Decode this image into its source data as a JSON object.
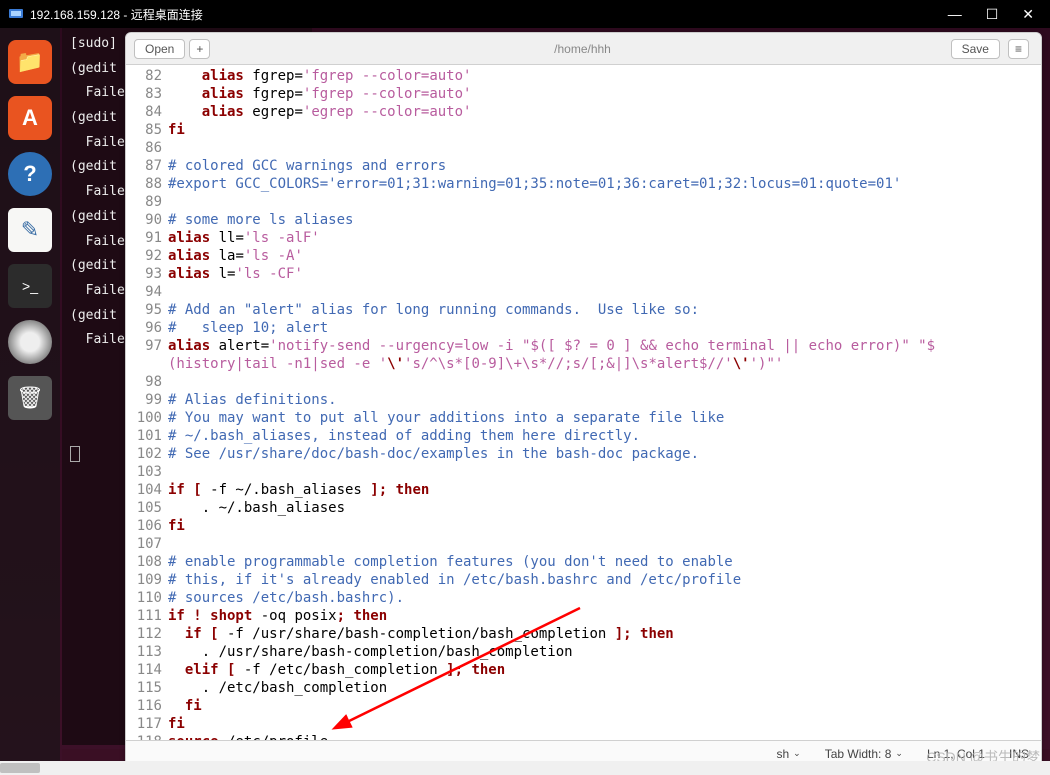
{
  "titlebar": {
    "title": "192.168.159.128 - 远程桌面连接"
  },
  "window_controls": {
    "min": "—",
    "max": "☐",
    "close": "✕"
  },
  "dock": {
    "files": "📁",
    "software": "A",
    "help": "?",
    "gedit": "✎",
    "terminal": ">_",
    "disc": "⦿",
    "trash": "🗑"
  },
  "terminal_lines": [
    "[sudo]",
    "",
    "(gedit",
    "  Faile",
    "",
    "(gedit",
    "  Faile",
    "",
    "(gedit",
    "  Faile",
    "",
    "(gedit",
    "  Faile",
    "",
    "(gedit",
    "  Faile",
    "",
    "(gedit",
    "  Faile"
  ],
  "editor": {
    "open_btn": "Open",
    "plus_btn": "+",
    "path": "/home/hhh",
    "save_btn": "Save",
    "menu_btn": "≡",
    "statusbar": {
      "lang": "sh",
      "tabwidth": "Tab Width: 8",
      "cursor": "Ln 1, Col 1",
      "ins": "INS"
    }
  },
  "code": [
    {
      "n": "82",
      "t": [
        [
          "    ",
          ""
        ],
        [
          "alias",
          "kw"
        ],
        [
          " fgrep=",
          ""
        ],
        [
          "'fgrep --color=auto'",
          "str"
        ]
      ],
      "partial_top": true
    },
    {
      "n": "83",
      "t": [
        [
          "    ",
          ""
        ],
        [
          "alias",
          "kw"
        ],
        [
          " fgrep=",
          ""
        ],
        [
          "'fgrep --color=auto'",
          "str"
        ]
      ]
    },
    {
      "n": "84",
      "t": [
        [
          "    ",
          ""
        ],
        [
          "alias",
          "kw"
        ],
        [
          " egrep=",
          ""
        ],
        [
          "'egrep --color=auto'",
          "str"
        ]
      ]
    },
    {
      "n": "85",
      "t": [
        [
          "fi",
          "kw"
        ]
      ]
    },
    {
      "n": "86",
      "t": []
    },
    {
      "n": "87",
      "t": [
        [
          "# colored GCC warnings and errors",
          "cmt"
        ]
      ]
    },
    {
      "n": "88",
      "t": [
        [
          "#export GCC_COLORS='error=01;31:warning=01;35:note=01;36:caret=01;32:locus=01:quote=01'",
          "cmt"
        ]
      ]
    },
    {
      "n": "89",
      "t": []
    },
    {
      "n": "90",
      "t": [
        [
          "# some more ls aliases",
          "cmt"
        ]
      ]
    },
    {
      "n": "91",
      "t": [
        [
          "alias",
          "kw"
        ],
        [
          " ll=",
          ""
        ],
        [
          "'ls -alF'",
          "str"
        ]
      ]
    },
    {
      "n": "92",
      "t": [
        [
          "alias",
          "kw"
        ],
        [
          " la=",
          ""
        ],
        [
          "'ls -A'",
          "str"
        ]
      ]
    },
    {
      "n": "93",
      "t": [
        [
          "alias",
          "kw"
        ],
        [
          " l=",
          ""
        ],
        [
          "'ls -CF'",
          "str"
        ]
      ]
    },
    {
      "n": "94",
      "t": []
    },
    {
      "n": "95",
      "t": [
        [
          "# Add an \"alert\" alias for long running commands.  Use like so:",
          "cmt"
        ]
      ]
    },
    {
      "n": "96",
      "t": [
        [
          "#   sleep 10; alert",
          "cmt"
        ]
      ]
    },
    {
      "n": "97",
      "t": [
        [
          "alias",
          "kw"
        ],
        [
          " alert=",
          ""
        ],
        [
          "'notify-send --urgency=low -i \"$([ $? = 0 ] && echo terminal || echo error)\" \"$",
          "str"
        ]
      ]
    },
    {
      "n": "",
      "t": [
        [
          "(history|tail -n1|sed -e '",
          "str"
        ],
        [
          "\\'",
          "kw"
        ],
        [
          "'s/^\\s*[0-9]\\+\\s*//;s/[;&|]\\s*alert$//'",
          "str"
        ],
        [
          "\\'",
          "kw"
        ],
        [
          "')\"'",
          "str"
        ]
      ]
    },
    {
      "n": "98",
      "t": []
    },
    {
      "n": "99",
      "t": [
        [
          "# Alias definitions.",
          "cmt"
        ]
      ]
    },
    {
      "n": "100",
      "t": [
        [
          "# You may want to put all your additions into a separate file like",
          "cmt"
        ]
      ]
    },
    {
      "n": "101",
      "t": [
        [
          "# ~/.bash_aliases, instead of adding them here directly.",
          "cmt"
        ]
      ]
    },
    {
      "n": "102",
      "t": [
        [
          "# See /usr/share/doc/bash-doc/examples in the bash-doc package.",
          "cmt"
        ]
      ]
    },
    {
      "n": "103",
      "t": []
    },
    {
      "n": "104",
      "t": [
        [
          "if [",
          "kw"
        ],
        [
          " -f ~/.bash_aliases ",
          ""
        ],
        [
          "]; then",
          "kw"
        ]
      ]
    },
    {
      "n": "105",
      "t": [
        [
          "    . ~/.bash_aliases",
          ""
        ]
      ]
    },
    {
      "n": "106",
      "t": [
        [
          "fi",
          "kw"
        ]
      ]
    },
    {
      "n": "107",
      "t": []
    },
    {
      "n": "108",
      "t": [
        [
          "# enable programmable completion features (you don't need to enable",
          "cmt"
        ]
      ]
    },
    {
      "n": "109",
      "t": [
        [
          "# this, if it's already enabled in /etc/bash.bashrc and /etc/profile",
          "cmt"
        ]
      ]
    },
    {
      "n": "110",
      "t": [
        [
          "# sources /etc/bash.bashrc).",
          "cmt"
        ]
      ]
    },
    {
      "n": "111",
      "t": [
        [
          "if ! shopt",
          "kw"
        ],
        [
          " -oq posix",
          ""
        ],
        [
          "; then",
          "kw"
        ]
      ]
    },
    {
      "n": "112",
      "t": [
        [
          "  ",
          ""
        ],
        [
          "if [",
          "kw"
        ],
        [
          " -f /usr/share/bash-completion/bash_completion ",
          ""
        ],
        [
          "]; then",
          "kw"
        ]
      ]
    },
    {
      "n": "113",
      "t": [
        [
          "    . /usr/share/bash-completion/bash_completion",
          ""
        ]
      ]
    },
    {
      "n": "114",
      "t": [
        [
          "  ",
          ""
        ],
        [
          "elif [",
          "kw"
        ],
        [
          " -f /etc/bash_completion ",
          ""
        ],
        [
          "]; then",
          "kw"
        ]
      ]
    },
    {
      "n": "115",
      "t": [
        [
          "    . /etc/bash_completion",
          ""
        ]
      ]
    },
    {
      "n": "116",
      "t": [
        [
          "  ",
          ""
        ],
        [
          "fi",
          "kw"
        ]
      ]
    },
    {
      "n": "117",
      "t": [
        [
          "fi",
          "kw"
        ]
      ]
    },
    {
      "n": "118",
      "t": [
        [
          "source",
          "kw"
        ],
        [
          " /etc/profile",
          ""
        ]
      ]
    }
  ],
  "watermark": "CSDN @书生的梦"
}
